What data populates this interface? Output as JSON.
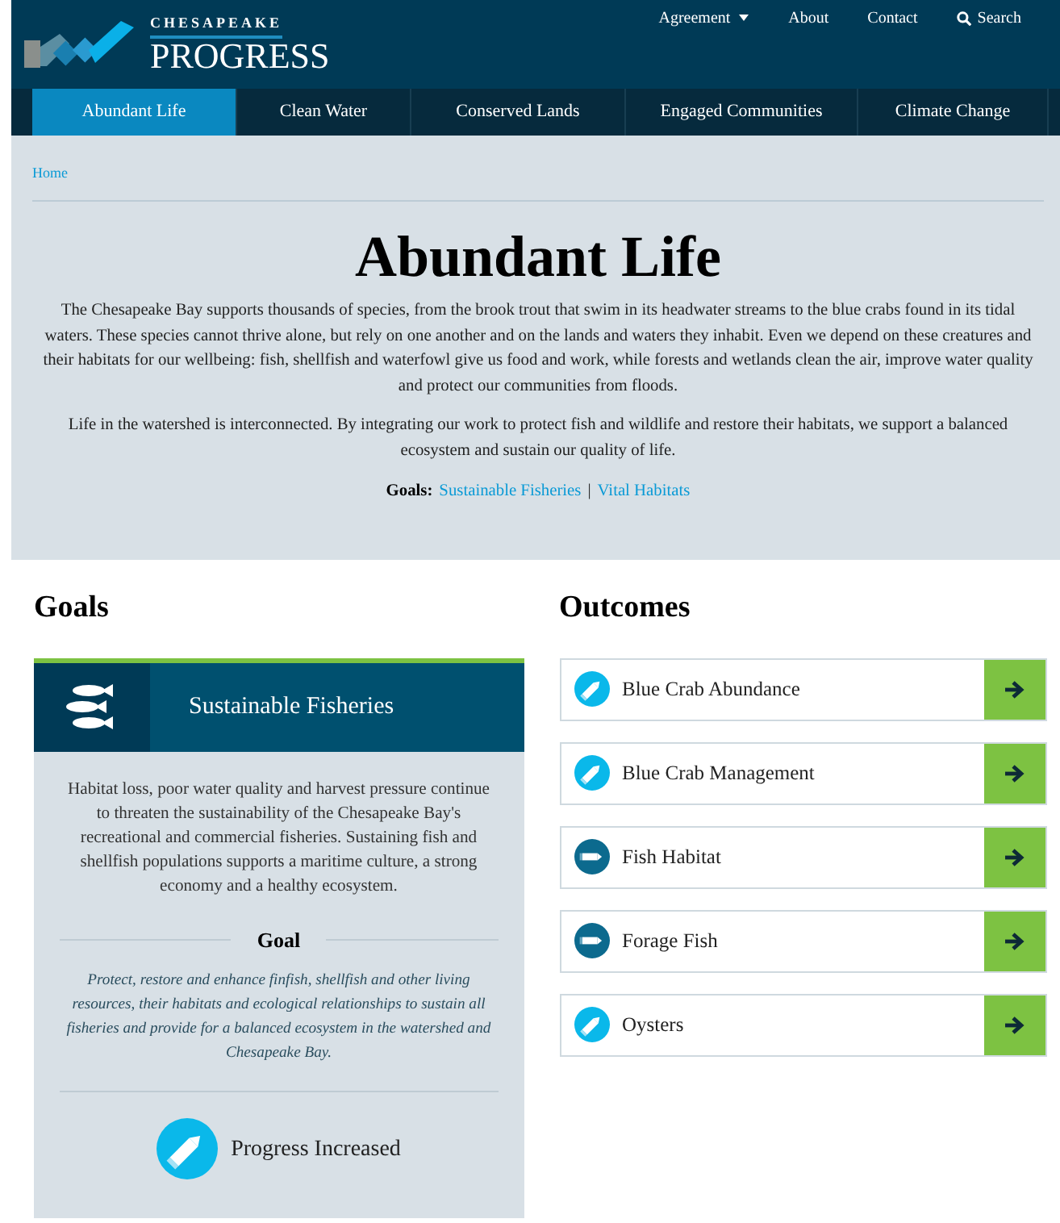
{
  "header": {
    "logo_small": "CHESAPEAKE",
    "logo_large": "PROGRESS",
    "top_links": [
      {
        "label": "Agreement",
        "kind": "dropdown"
      },
      {
        "label": "About",
        "kind": "link"
      },
      {
        "label": "Contact",
        "kind": "link"
      },
      {
        "label": "Search",
        "kind": "search"
      }
    ]
  },
  "tabs": [
    {
      "label": "Abundant Life",
      "selected": true
    },
    {
      "label": "Clean Water",
      "selected": false
    },
    {
      "label": "Conserved Lands",
      "selected": false
    },
    {
      "label": "Engaged Communities",
      "selected": false
    },
    {
      "label": "Climate Change",
      "selected": false
    }
  ],
  "breadcrumb": "Home",
  "hero": {
    "title": "Abundant Life",
    "paragraphs": [
      "The Chesapeake Bay supports thousands of species, from the brook trout that swim in its headwater streams to the blue crabs found in its tidal waters. These species cannot thrive alone, but rely on one another and on the lands and waters they inhabit. Even we depend on these creatures and their habitats for our wellbeing: fish, shellfish and waterfowl give us food and work, while forests and wetlands clean the air, improve water quality and protect our communities from floods.",
      "Life in the watershed is interconnected. By integrating our work to protect fish and wildlife and restore their habitats, we support a balanced ecosystem and sustain our quality of life."
    ],
    "goals_label": "Goals:",
    "goal_links": [
      "Sustainable Fisheries",
      "Vital Habitats"
    ],
    "separator": "|"
  },
  "goals": {
    "heading": "Goals",
    "card": {
      "title": "Sustainable Fisheries",
      "description": "Habitat loss, poor water quality and harvest pressure continue to threaten the sustainability of the Chesapeake Bay's recreational and commercial fisheries. Sustaining fish and shellfish populations supports a maritime culture, a strong economy and a healthy ecosystem.",
      "goal_heading": "Goal",
      "goal_text": "Protect, restore and enhance finfish, shellfish and other living resources, their habitats and ecological relationships to sustain all fisheries and provide for a balanced ecosystem in the watershed and Chesapeake Bay.",
      "progress": {
        "kind": "increasing",
        "label": "Progress Increased"
      }
    }
  },
  "outcomes": {
    "heading": "Outcomes",
    "items": [
      {
        "label": "Blue Crab Abundance",
        "kind": "increasing"
      },
      {
        "label": "Blue Crab Management",
        "kind": "increasing"
      },
      {
        "label": "Fish Habitat",
        "kind": "steady"
      },
      {
        "label": "Forage Fish",
        "kind": "steady"
      },
      {
        "label": "Oysters",
        "kind": "increasing"
      }
    ]
  }
}
